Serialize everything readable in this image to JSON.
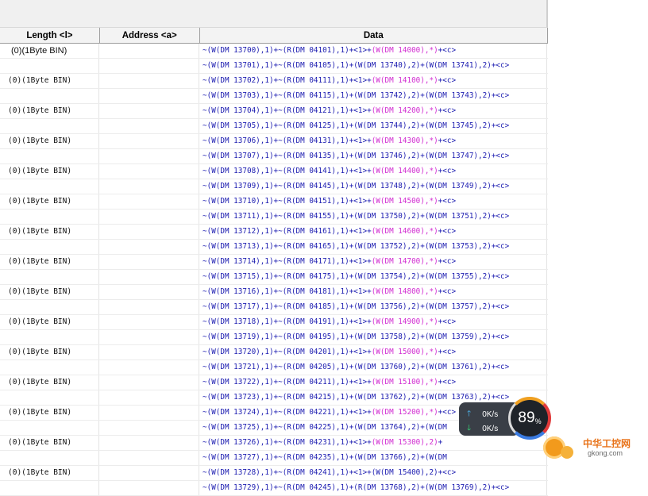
{
  "columns": {
    "length": "Length <l>",
    "address": "Address <a>",
    "data": "Data"
  },
  "rows": [
    {
      "len": "(0)(1Byte BIN)",
      "d": [
        [
          "~(W(DM 13700),1)+~(R(DM 04101),1)+<1>+",
          ""
        ],
        [
          "(W(DM 14000),*)",
          "pink"
        ],
        [
          "+<c>",
          ""
        ]
      ]
    },
    {
      "len": "",
      "d": [
        [
          "~(W(DM 13701),1)+~(R(DM 04105),1)+(W(DM 13740),2)+(W(DM 13741),2)+<c>",
          ""
        ]
      ]
    },
    {
      "len": "(0)(1Byte BIN)",
      "d": [
        [
          "~(W(DM 13702),1)+~(R(DM 04111),1)+<1>+",
          ""
        ],
        [
          "(W(DM 14100),*)",
          "pink"
        ],
        [
          "+<c>",
          ""
        ]
      ]
    },
    {
      "len": "",
      "d": [
        [
          "~(W(DM 13703),1)+~(R(DM 04115),1)+(W(DM 13742),2)+(W(DM 13743),2)+<c>",
          ""
        ]
      ]
    },
    {
      "len": "(0)(1Byte BIN)",
      "d": [
        [
          "~(W(DM 13704),1)+~(R(DM 04121),1)+<1>+",
          ""
        ],
        [
          "(W(DM 14200),*)",
          "pink"
        ],
        [
          "+<c>",
          ""
        ]
      ]
    },
    {
      "len": "",
      "d": [
        [
          "~(W(DM 13705),1)+~(R(DM 04125),1)+(W(DM 13744),2)+(W(DM 13745),2)+<c>",
          ""
        ]
      ]
    },
    {
      "len": "(0)(1Byte BIN)",
      "d": [
        [
          "~(W(DM 13706),1)+~(R(DM 04131),1)+<1>+",
          ""
        ],
        [
          "(W(DM 14300),*)",
          "pink"
        ],
        [
          "+<c>",
          ""
        ]
      ]
    },
    {
      "len": "",
      "d": [
        [
          "~(W(DM 13707),1)+~(R(DM 04135),1)+(W(DM 13746),2)+(W(DM 13747),2)+<c>",
          ""
        ]
      ]
    },
    {
      "len": "(0)(1Byte BIN)",
      "d": [
        [
          "~(W(DM 13708),1)+~(R(DM 04141),1)+<1>+",
          ""
        ],
        [
          "(W(DM 14400),*)",
          "pink"
        ],
        [
          "+<c>",
          ""
        ]
      ]
    },
    {
      "len": "",
      "d": [
        [
          "~(W(DM 13709),1)+~(R(DM 04145),1)+(W(DM 13748),2)+(W(DM 13749),2)+<c>",
          ""
        ]
      ]
    },
    {
      "len": "(0)(1Byte BIN)",
      "d": [
        [
          "~(W(DM 13710),1)+~(R(DM 04151),1)+<1>+",
          ""
        ],
        [
          "(W(DM 14500),*)",
          "pink"
        ],
        [
          "+<c>",
          ""
        ]
      ]
    },
    {
      "len": "",
      "d": [
        [
          "~(W(DM 13711),1)+~(R(DM 04155),1)+(W(DM 13750),2)+(W(DM 13751),2)+<c>",
          ""
        ]
      ]
    },
    {
      "len": "(0)(1Byte BIN)",
      "d": [
        [
          "~(W(DM 13712),1)+~(R(DM 04161),1)+<1>+",
          ""
        ],
        [
          "(W(DM 14600),*)",
          "pink"
        ],
        [
          "+<c>",
          ""
        ]
      ]
    },
    {
      "len": "",
      "d": [
        [
          "~(W(DM 13713),1)+~(R(DM 04165),1)+(W(DM 13752),2)+(W(DM 13753),2)+<c>",
          ""
        ]
      ]
    },
    {
      "len": "(0)(1Byte BIN)",
      "d": [
        [
          "~(W(DM 13714),1)+~(R(DM 04171),1)+<1>+",
          ""
        ],
        [
          "(W(DM 14700),*)",
          "pink"
        ],
        [
          "+<c>",
          ""
        ]
      ]
    },
    {
      "len": "",
      "d": [
        [
          "~(W(DM 13715),1)+~(R(DM 04175),1)+(W(DM 13754),2)+(W(DM 13755),2)+<c>",
          ""
        ]
      ]
    },
    {
      "len": "(0)(1Byte BIN)",
      "d": [
        [
          "~(W(DM 13716),1)+~(R(DM 04181),1)+<1>+",
          ""
        ],
        [
          "(W(DM 14800),*)",
          "pink"
        ],
        [
          "+<c>",
          ""
        ]
      ]
    },
    {
      "len": "",
      "d": [
        [
          "~(W(DM 13717),1)+~(R(DM 04185),1)+(W(DM 13756),2)+(W(DM 13757),2)+<c>",
          ""
        ]
      ]
    },
    {
      "len": "(0)(1Byte BIN)",
      "d": [
        [
          "~(W(DM 13718),1)+~(R(DM 04191),1)+<1>+",
          ""
        ],
        [
          "(W(DM 14900),*)",
          "pink"
        ],
        [
          "+<c>",
          ""
        ]
      ]
    },
    {
      "len": "",
      "d": [
        [
          "~(W(DM 13719),1)+~(R(DM 04195),1)+(W(DM 13758),2)+(W(DM 13759),2)+<c>",
          ""
        ]
      ]
    },
    {
      "len": "(0)(1Byte BIN)",
      "d": [
        [
          "~(W(DM 13720),1)+~(R(DM 04201),1)+<1>+",
          ""
        ],
        [
          "(W(DM 15000),*)",
          "pink"
        ],
        [
          "+<c>",
          ""
        ]
      ]
    },
    {
      "len": "",
      "d": [
        [
          "~(W(DM 13721),1)+~(R(DM 04205),1)+(W(DM 13760),2)+(W(DM 13761),2)+<c>",
          ""
        ]
      ]
    },
    {
      "len": "(0)(1Byte BIN)",
      "d": [
        [
          "~(W(DM 13722),1)+~(R(DM 04211),1)+<1>+",
          ""
        ],
        [
          "(W(DM 15100),*)",
          "pink"
        ],
        [
          "+<c>",
          ""
        ]
      ]
    },
    {
      "len": "",
      "d": [
        [
          "~(W(DM 13723),1)+~(R(DM 04215),1)+(W(DM 13762),2)+(W(DM 13763),2)+<c>",
          ""
        ]
      ]
    },
    {
      "len": "(0)(1Byte BIN)",
      "d": [
        [
          "~(W(DM 13724),1)+~(R(DM 04221),1)+<1>+",
          ""
        ],
        [
          "(W(DM 15200),*)",
          "pink"
        ],
        [
          "+<c>",
          ""
        ]
      ]
    },
    {
      "len": "",
      "d": [
        [
          "~(W(DM 13725),1)+~(R(DM 04225),1)+(W(DM 13764),2)+(W(DM",
          ""
        ]
      ]
    },
    {
      "len": "(0)(1Byte BIN)",
      "d": [
        [
          "~(W(DM 13726),1)+~(R(DM 04231),1)+<1>+",
          ""
        ],
        [
          "(W(DM 15300),2)",
          "pink"
        ],
        [
          "+",
          ""
        ]
      ]
    },
    {
      "len": "",
      "d": [
        [
          "~(W(DM 13727),1)+~(R(DM 04235),1)+(W(DM 13766),2)+(W(DM",
          ""
        ]
      ]
    },
    {
      "len": "(0)(1Byte BIN)",
      "d": [
        [
          "~(W(DM 13728),1)+~(R(DM 04241),1)+<1>+(W(DM 15400),2)+<c>",
          ""
        ]
      ]
    },
    {
      "len": "",
      "d": [
        [
          "~(W(DM 13729),1)+~(R(DM 04245),1)+(R(DM 13768),2)+(W(DM 13769),2)+<c>",
          ""
        ]
      ]
    }
  ],
  "widget": {
    "upload": "0K/s",
    "download": "0K/s",
    "up_icon": "arrow-up-icon",
    "down_icon": "arrow-down-icon",
    "gauge_value": "89",
    "gauge_unit": "%"
  },
  "watermark": {
    "cn": "中华工控网",
    "url": "gkong.com"
  },
  "colors": {
    "data_text": "#1b1bb0",
    "write_highlight": "#d12bd1"
  }
}
